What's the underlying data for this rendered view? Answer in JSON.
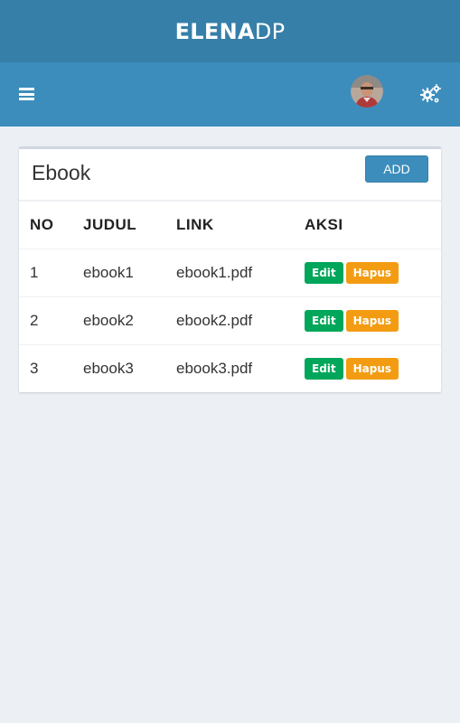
{
  "brand": {
    "bold": "ELENA",
    "light": "DP"
  },
  "navbar": {
    "menu_icon": "hamburger-menu-icon",
    "avatar_icon": "user-avatar",
    "settings_icon": "gears-icon"
  },
  "panel": {
    "title": "Ebook",
    "add_label": "ADD"
  },
  "table": {
    "headers": [
      "NO",
      "JUDUL",
      "LINK",
      "AKSI"
    ],
    "rows": [
      {
        "no": "1",
        "judul": "ebook1",
        "link": "ebook1.pdf",
        "edit": "Edit",
        "hapus": "Hapus"
      },
      {
        "no": "2",
        "judul": "ebook2",
        "link": "ebook2.pdf",
        "edit": "Edit",
        "hapus": "Hapus"
      },
      {
        "no": "3",
        "judul": "ebook3",
        "link": "ebook3.pdf",
        "edit": "Edit",
        "hapus": "Hapus"
      }
    ]
  },
  "colors": {
    "brand_bar": "#367fa9",
    "navbar": "#3c8dbc",
    "edit": "#00a65a",
    "hapus": "#f39c12",
    "background": "#ecf0f5"
  }
}
